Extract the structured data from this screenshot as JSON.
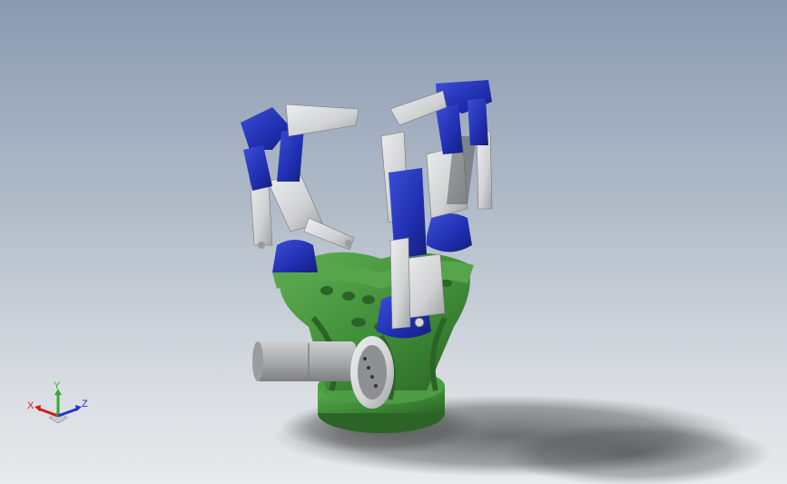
{
  "viewport": {
    "background_top": "#8b9ab1",
    "background_bottom": "#e8eaec"
  },
  "model": {
    "parts": {
      "base_color": "#3f8f3a",
      "actuator_color": "#1f2fb0",
      "link_color": "#d4d6d8",
      "motor_color": "#b9bbbd"
    }
  },
  "triad": {
    "x_label": "X",
    "y_label": "Y",
    "z_label": "Z",
    "x_color": "#d01c1c",
    "y_color": "#2fae2f",
    "z_color": "#2436c8"
  }
}
